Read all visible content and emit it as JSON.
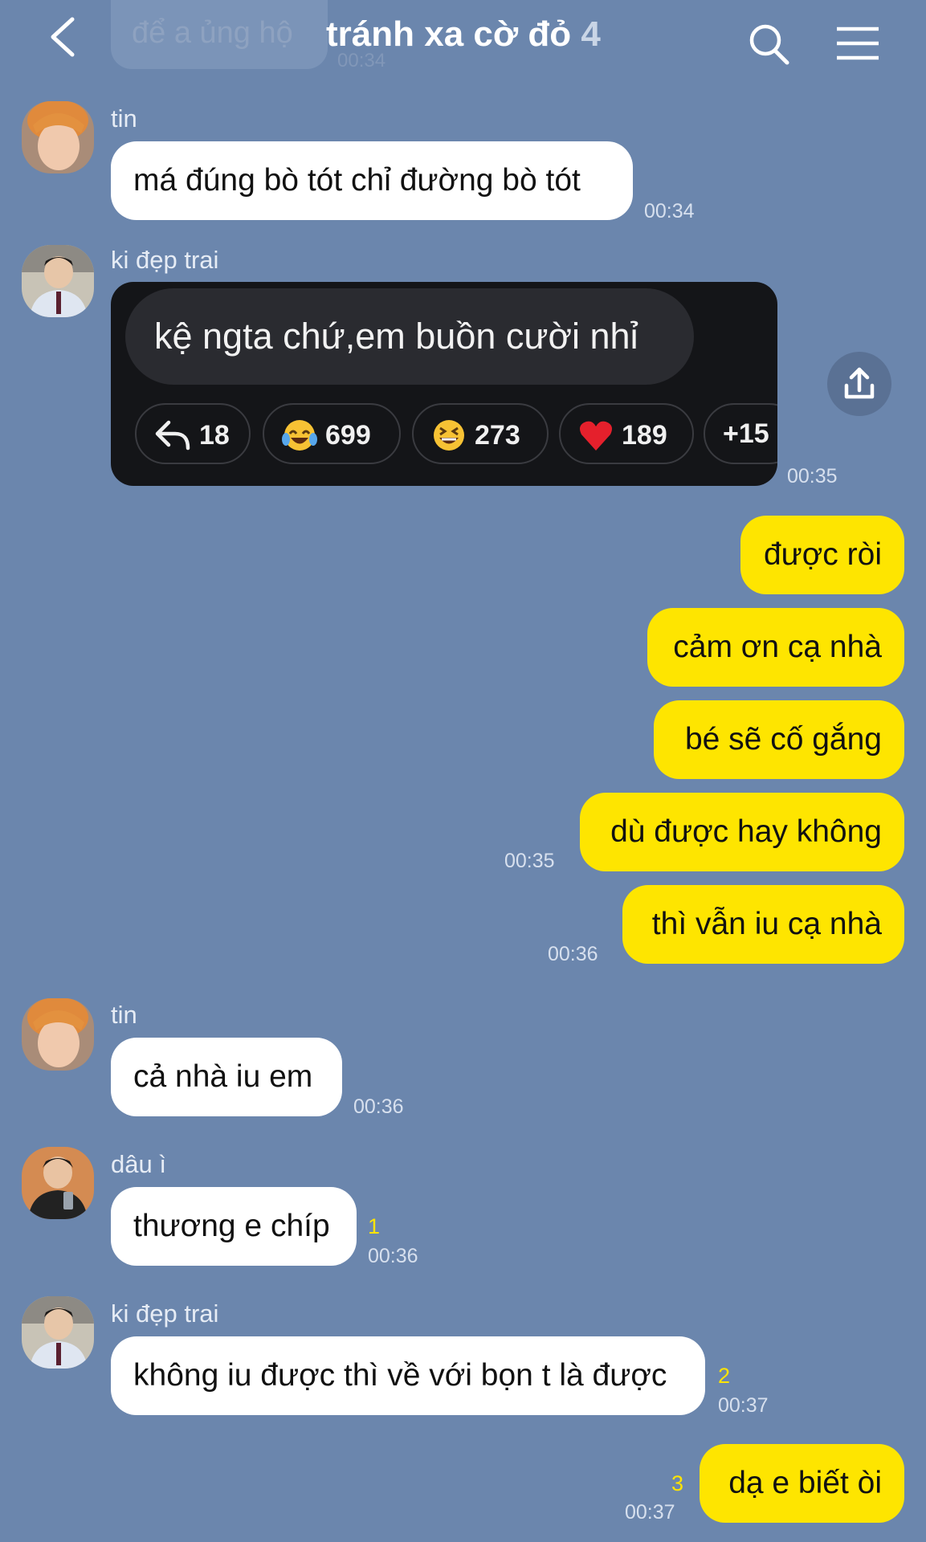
{
  "header": {
    "ghost_message": "để a ủng hộ",
    "ghost_time": "00:34",
    "title": "tránh xa cờ đỏ",
    "member_count": "4"
  },
  "messages": {
    "m1": {
      "sender": "tin",
      "text": "má đúng bò tót chỉ đường bò tót",
      "time": "00:34"
    },
    "m2": {
      "sender": "ki đẹp trai",
      "time": "00:35",
      "image": {
        "text": "kệ ngta chứ,em buồn cười nhỉ",
        "reactions": [
          {
            "icon": "reply-icon",
            "count": "18"
          },
          {
            "icon": "laugh-cry-emoji",
            "count": "699"
          },
          {
            "icon": "grin-squint-emoji",
            "count": "273"
          },
          {
            "icon": "red-heart-emoji",
            "count": "189"
          },
          {
            "icon": "more",
            "count": "+15"
          }
        ]
      }
    },
    "out1": {
      "text": "được ròi"
    },
    "out2": {
      "text": "cảm ơn cạ nhà"
    },
    "out3": {
      "text": "bé sẽ cố gắng"
    },
    "out4": {
      "text": "dù được hay không",
      "time": "00:35"
    },
    "out5": {
      "text": "thì vẫn iu cạ nhà",
      "time": "00:36"
    },
    "m3": {
      "sender": "tin",
      "text": "cả nhà iu em",
      "time": "00:36"
    },
    "m4": {
      "sender": "dâu ì",
      "text": "thương e chíp",
      "unread": "1",
      "time": "00:36"
    },
    "m5": {
      "sender": "ki đẹp trai",
      "text": "không iu được thì về với bọn t là được",
      "unread": "2",
      "time": "00:37"
    },
    "out6": {
      "text": "dạ e biết òi",
      "unread": "3",
      "time": "00:37"
    }
  },
  "colors": {
    "background": "#6b86ad",
    "outgoing_bubble": "#fee500",
    "incoming_bubble": "#ffffff",
    "unread_count": "#ffe400"
  }
}
